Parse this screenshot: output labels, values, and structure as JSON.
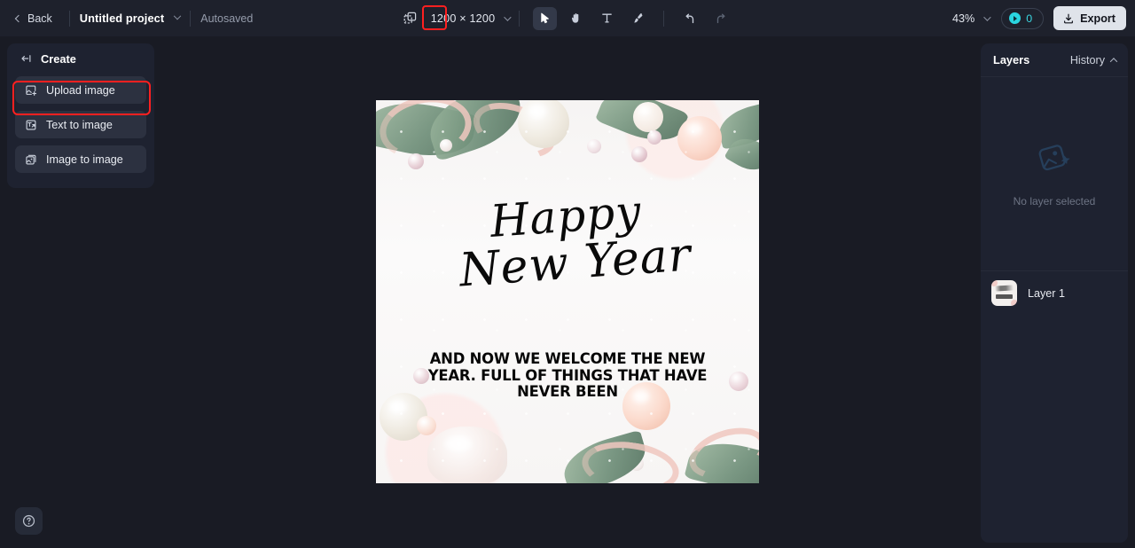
{
  "topbar": {
    "back_label": "Back",
    "project_name": "Untitled project",
    "autosaved_label": "Autosaved",
    "resize_icon": "resize-canvas-icon",
    "dimensions": "1200 × 1200",
    "tools": [
      {
        "name": "select-tool",
        "icon": "cursor-arrow-icon",
        "active": true
      },
      {
        "name": "hand-tool",
        "icon": "hand-icon",
        "active": false
      },
      {
        "name": "text-tool",
        "icon": "text-t-icon",
        "active": false
      },
      {
        "name": "brush-tool",
        "icon": "paintbrush-icon",
        "active": false
      }
    ],
    "undo_icon": "undo-arrow-icon",
    "redo_icon": "redo-arrow-icon",
    "zoom_level": "43%",
    "credits_count": "0",
    "credits_icon": "credit-token-icon",
    "export_label": "Export",
    "export_icon": "download-icon"
  },
  "left_panel": {
    "title": "Create",
    "collapse_icon": "collapse-panel-icon",
    "items": [
      {
        "label": "Upload image",
        "icon": "upload-image-icon",
        "highlighted": true
      },
      {
        "label": "Text to image",
        "icon": "text-to-image-icon",
        "highlighted": false
      },
      {
        "label": "Image to image",
        "icon": "image-to-image-icon",
        "highlighted": false
      }
    ],
    "help_icon": "help-question-icon"
  },
  "right_panel": {
    "layers_title": "Layers",
    "history_label": "History",
    "history_chevron": "chevron-up-icon",
    "empty_icon": "no-selection-image-icon",
    "empty_message": "No layer selected",
    "layers": [
      {
        "name": "Layer 1",
        "thumbnail": "new-year-card-thumbnail"
      }
    ]
  },
  "canvas": {
    "artboard_label": "new-year-greeting-artboard",
    "headline_line1": "Happy",
    "headline_line2": "New Year",
    "body_text": "And now we welcome the new year. Full of things that have never been"
  },
  "colors": {
    "topbar_bg": "#1e212c",
    "workspace_bg": "#191b24",
    "panel_bg": "#1e2230",
    "panel_item_bg": "#2c3140",
    "accent_cyan": "#3ad8e3",
    "highlight_red": "#ff2020",
    "export_bg": "#dfe3ea"
  }
}
